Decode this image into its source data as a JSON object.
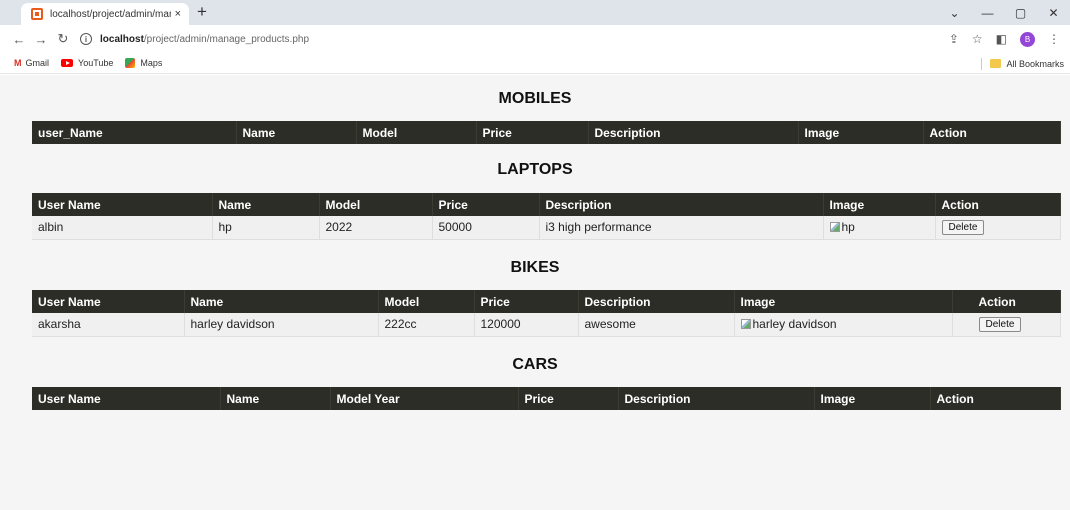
{
  "browser": {
    "tab_title": "localhost/project/admin/manag",
    "tab_close": "×",
    "new_tab": "+",
    "url_host": "localhost",
    "url_path": "/project/admin/manage_products.php",
    "bookmarks": [
      "Gmail",
      "YouTube",
      "Maps"
    ],
    "all_bookmarks": "All Bookmarks",
    "profile_initial": "B"
  },
  "mobiles": {
    "heading": "MOBILES",
    "columns": [
      "user_Name",
      "Name",
      "Model",
      "Price",
      "Description",
      "Image",
      "Action"
    ],
    "rows": []
  },
  "laptops": {
    "heading": "LAPTOPS",
    "columns": [
      "User Name",
      "Name",
      "Model",
      "Price",
      "Description",
      "Image",
      "Action"
    ],
    "rows": [
      {
        "user": "albin",
        "name": "hp",
        "model": "2022",
        "price": "50000",
        "description": "i3 high performance",
        "image_alt": "hp",
        "action": "Delete"
      }
    ]
  },
  "bikes": {
    "heading": "BIKES",
    "columns": [
      "User Name",
      "Name",
      "Model",
      "Price",
      "Description",
      "Image",
      "Action"
    ],
    "rows": [
      {
        "user": "akarsha",
        "name": "harley davidson",
        "model": "222cc",
        "price": "120000",
        "description": "awesome",
        "image_alt": "harley davidson",
        "action": "Delete"
      }
    ]
  },
  "cars": {
    "heading": "CARS",
    "columns": [
      "User Name",
      "Name",
      "Model Year",
      "Price",
      "Description",
      "Image",
      "Action"
    ],
    "rows": []
  }
}
